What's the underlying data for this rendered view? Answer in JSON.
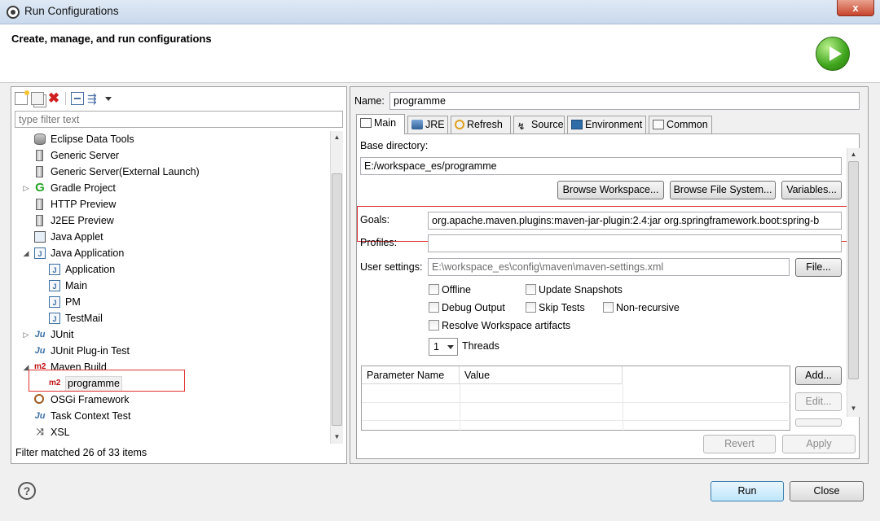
{
  "window": {
    "title": "Run Configurations",
    "close_symbol": "x"
  },
  "header": {
    "heading": "Create, manage, and run configurations"
  },
  "left": {
    "filter_placeholder": "type filter text",
    "tree": [
      {
        "label": "Eclipse Data Tools",
        "icon": "database-icon",
        "twisty": ""
      },
      {
        "label": "Generic Server",
        "icon": "server-icon",
        "twisty": ""
      },
      {
        "label": "Generic Server(External Launch)",
        "icon": "server-icon",
        "twisty": ""
      },
      {
        "label": "Gradle Project",
        "icon": "gradle-icon",
        "twisty": "▷"
      },
      {
        "label": "HTTP Preview",
        "icon": "server-icon",
        "twisty": ""
      },
      {
        "label": "J2EE Preview",
        "icon": "server-icon",
        "twisty": ""
      },
      {
        "label": "Java Applet",
        "icon": "applet-icon",
        "twisty": ""
      },
      {
        "label": "Java Application",
        "icon": "java-app-icon",
        "twisty": "◢"
      },
      {
        "label": "Application",
        "icon": "java-app-icon",
        "twisty": "",
        "child": true
      },
      {
        "label": "Main",
        "icon": "java-app-icon",
        "twisty": "",
        "child": true
      },
      {
        "label": "PM",
        "icon": "java-app-icon",
        "twisty": "",
        "child": true
      },
      {
        "label": "TestMail",
        "icon": "java-app-icon",
        "twisty": "",
        "child": true
      },
      {
        "label": "JUnit",
        "icon": "junit-icon",
        "twisty": "▷"
      },
      {
        "label": "JUnit Plug-in Test",
        "icon": "junit-icon",
        "twisty": ""
      },
      {
        "label": "Maven Build",
        "icon": "maven-icon",
        "twisty": "◢"
      },
      {
        "label": "programme",
        "icon": "maven-icon",
        "twisty": "",
        "child": true,
        "selected": true
      },
      {
        "label": "OSGi Framework",
        "icon": "osgi-icon",
        "twisty": ""
      },
      {
        "label": "Task Context Test",
        "icon": "junit-icon",
        "twisty": ""
      },
      {
        "label": "XSL",
        "icon": "xsl-icon",
        "twisty": ""
      }
    ],
    "filter_status": "Filter matched 26 of 33 items"
  },
  "right": {
    "name_label": "Name:",
    "name_value": "programme",
    "tabs": [
      {
        "label": "Main",
        "icon": "main-tab-icon"
      },
      {
        "label": "JRE",
        "icon": "jre-icon"
      },
      {
        "label": "Refresh",
        "icon": "refresh-icon"
      },
      {
        "label": "Source",
        "icon": "source-icon"
      },
      {
        "label": "Environment",
        "icon": "environment-icon"
      },
      {
        "label": "Common",
        "icon": "common-icon"
      }
    ],
    "base_dir_label": "Base directory:",
    "base_dir_value": "E:/workspace_es/programme",
    "browse_workspace": "Browse Workspace...",
    "browse_fs": "Browse File System...",
    "variables": "Variables...",
    "goals_label": "Goals:",
    "goals_value": "org.apache.maven.plugins:maven-jar-plugin:2.4:jar org.springframework.boot:spring-b",
    "profiles_label": "Profiles:",
    "profiles_value": "",
    "user_settings_label": "User settings:",
    "user_settings_value": "E:\\workspace_es\\config\\maven\\maven-settings.xml",
    "file_button": "File...",
    "checks": {
      "offline": "Offline",
      "update_snapshots": "Update Snapshots",
      "debug_output": "Debug Output",
      "skip_tests": "Skip Tests",
      "non_recursive": "Non-recursive",
      "resolve_workspace": "Resolve Workspace artifacts"
    },
    "threads_value": "1",
    "threads_label": "Threads",
    "param_columns": [
      "Parameter Name",
      "Value"
    ],
    "add_button": "Add...",
    "edit_button": "Edit...",
    "revert_button": "Revert",
    "apply_button": "Apply"
  },
  "footer": {
    "help_symbol": "?",
    "run": "Run",
    "close": "Close"
  }
}
